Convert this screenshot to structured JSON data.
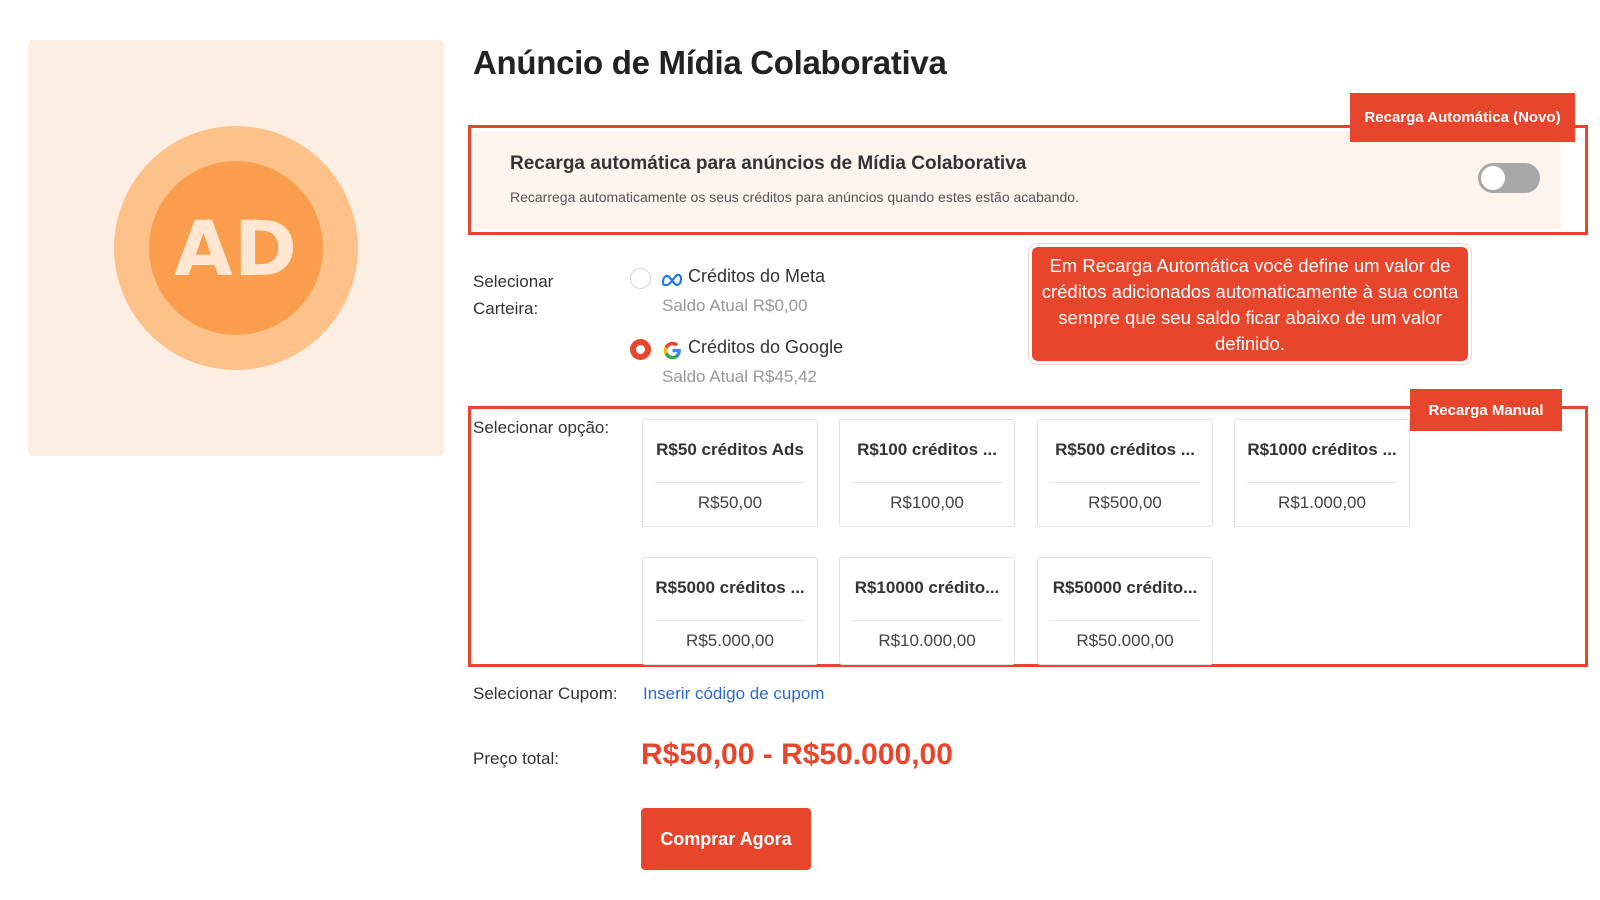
{
  "product": {
    "image_text": "AD",
    "title": "Anúncio de Mídia Colaborativa"
  },
  "auto_recharge": {
    "tag": "Recarga Automática (Novo)",
    "title": "Recarga automática para anúncios de Mídia Colaborativa",
    "description": "Recarrega automaticamente os seus créditos para anúncios quando estes estão acabando.",
    "toggle_on": false
  },
  "callout": {
    "text": "Em Recarga Automática você define um valor de créditos adicionados automaticamente à sua conta sempre que seu saldo ficar abaixo de um valor definido."
  },
  "wallet": {
    "label": "Selecionar Carteira:",
    "options": [
      {
        "name": "Créditos do Meta",
        "balance": "Saldo Atual R$0,00",
        "icon": "meta-icon",
        "selected": false
      },
      {
        "name": "Créditos do Google",
        "balance": "Saldo Atual R$45,42",
        "icon": "google-icon",
        "selected": true
      }
    ]
  },
  "manual": {
    "tag": "Recarga Manual",
    "label": "Selecionar opção:",
    "options": [
      {
        "name": "R$50 créditos Ads",
        "price": "R$50,00"
      },
      {
        "name": "R$100 créditos ...",
        "price": "R$100,00"
      },
      {
        "name": "R$500 créditos ...",
        "price": "R$500,00"
      },
      {
        "name": "R$1000 créditos ...",
        "price": "R$1.000,00"
      },
      {
        "name": "R$5000 créditos ...",
        "price": "R$5.000,00"
      },
      {
        "name": "R$10000 crédito...",
        "price": "R$10.000,00"
      },
      {
        "name": "R$50000 crédito...",
        "price": "R$50.000,00"
      }
    ]
  },
  "coupon": {
    "label": "Selecionar Cupom:",
    "link": "Inserir código de cupom"
  },
  "price": {
    "label": "Preço total:",
    "value": "R$50,00 - R$50.000,00"
  },
  "buy_button": "Comprar Agora",
  "colors": {
    "accent": "#e8452d",
    "link": "#2a6bd4",
    "image_bg": "#fdeee4",
    "toggle_off": "#a8a8a8"
  }
}
